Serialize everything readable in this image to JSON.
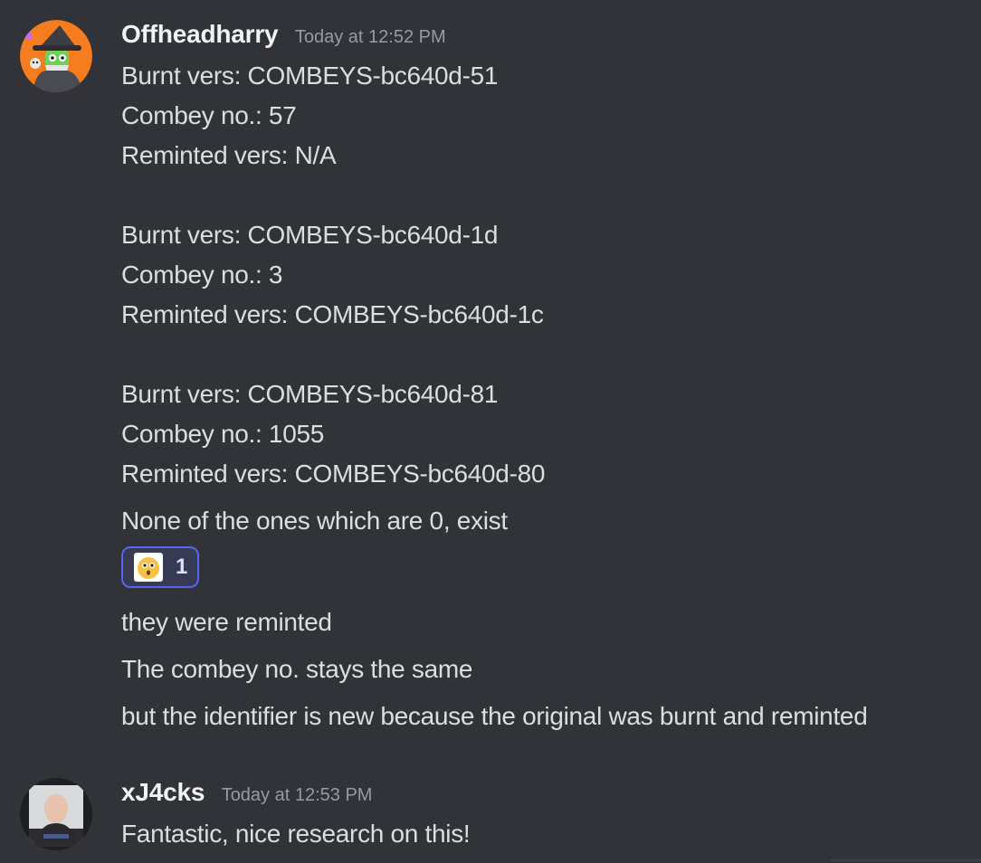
{
  "messages": [
    {
      "username": "Offheadharry",
      "timestamp": "Today at 12:52 PM",
      "avatar": "wizard-avatar",
      "lines": [
        "Burnt vers: COMBEYS-bc640d-51",
        "Combey no.: 57",
        "Reminted vers: N/A",
        "Burnt vers: COMBEYS-bc640d-1d",
        "Combey no.: 3",
        "Reminted vers: COMBEYS-bc640d-1c",
        "Burnt vers: COMBEYS-bc640d-81",
        "Combey no.: 1055",
        "Reminted vers: COMBEYS-bc640d-80",
        "None of the ones which are 0, exist"
      ],
      "reaction": {
        "emoji": "surprised-face-emoji",
        "count": "1",
        "accent": "#5865f2"
      },
      "followups": [
        "they were reminted",
        "The combey no. stays the same",
        "but the identifier is new because the original was burnt and reminted"
      ]
    },
    {
      "username": "xJ4cks",
      "timestamp": "Today at 12:53 PM",
      "avatar": "photo-avatar",
      "lines": [
        "Fantastic, nice research on this!"
      ]
    }
  ],
  "colors": {
    "background": "#313338",
    "text": "#dbdee1",
    "username": "#f2f3f5",
    "timestamp": "#949ba4"
  }
}
